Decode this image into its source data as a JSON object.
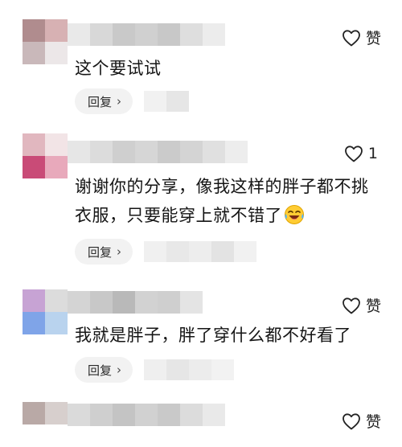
{
  "comments": [
    {
      "text_lines": [
        "这个要试试"
      ],
      "like_label": "赞",
      "reply_label": "回复",
      "reply_chevron": "›"
    },
    {
      "text_lines": [
        "谢谢你的分享，像我这样的胖子都不挑",
        "衣服，只要能穿上就不错了"
      ],
      "like_label": "1",
      "reply_label": "回复",
      "reply_chevron": "›",
      "emoji": "laughing-crying-emoji"
    },
    {
      "text_lines": [
        "我就是胖子，胖了穿什么都不好看了"
      ],
      "like_label": "赞",
      "reply_label": "回复",
      "reply_chevron": "›"
    },
    {
      "like_label": "赞"
    }
  ],
  "icons": {
    "like": "heart-outline-icon",
    "reply_chevron": "chevron-right-icon"
  },
  "colors": {
    "reply_bg": "#f2f2f2",
    "text": "#151515"
  }
}
